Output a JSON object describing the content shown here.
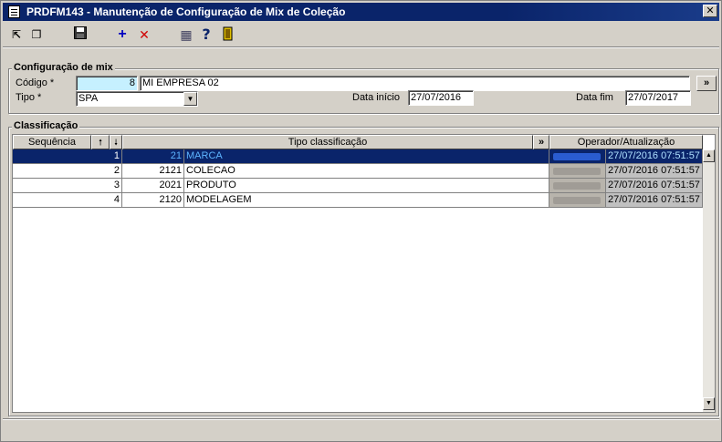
{
  "window": {
    "title": "PRDFM143 - Manutenção de Configuração de Mix de Coleção",
    "close_glyph": "✕"
  },
  "toolbar": {
    "buttons": [
      {
        "name": "export-icon",
        "glyph": "⇱"
      },
      {
        "name": "copy-icon",
        "glyph": "❐"
      },
      {
        "name": "save-icon",
        "glyph": "💾"
      },
      {
        "name": "add-icon",
        "glyph": "+"
      },
      {
        "name": "delete-icon",
        "glyph": "✕"
      },
      {
        "name": "calendar-icon",
        "glyph": "▦"
      },
      {
        "name": "help-icon",
        "glyph": "?"
      },
      {
        "name": "exit-door-icon",
        "glyph": "▯"
      }
    ]
  },
  "config": {
    "legend": "Configuração de mix",
    "codigo_label": "Código *",
    "codigo_value": "8",
    "empresa_value": "MI EMPRESA 02",
    "tipo_label": "Tipo *",
    "tipo_value": "SPA",
    "data_inicio_label": "Data início",
    "data_inicio_value": "27/07/2016",
    "data_fim_label": "Data fim",
    "data_fim_value": "27/07/2017",
    "lookup_button": "»"
  },
  "classificacao": {
    "legend": "Classificação",
    "headers": {
      "sequencia": "Sequência",
      "up": "🠕",
      "down": "🠗",
      "tipo": "Tipo classificação",
      "expand": "»",
      "operador": "Operador/Atualização"
    },
    "rows": [
      {
        "seq": "1",
        "codigo": "21",
        "descricao": "MARCA",
        "timestamp": "27/07/2016 07:51:57",
        "selected": true
      },
      {
        "seq": "2",
        "codigo": "2121",
        "descricao": "COLECAO",
        "timestamp": "27/07/2016 07:51:57",
        "selected": false
      },
      {
        "seq": "3",
        "codigo": "2021",
        "descricao": "PRODUTO",
        "timestamp": "27/07/2016 07:51:57",
        "selected": false
      },
      {
        "seq": "4",
        "codigo": "2120",
        "descricao": "MODELAGEM",
        "timestamp": "27/07/2016 07:51:57",
        "selected": false
      }
    ]
  },
  "colors": {
    "title_bar": "#0a246a",
    "selection": "#0a246a",
    "code_field_bg": "#c6f0ff",
    "add_icon": "#0000c0",
    "delete_icon": "#d00000"
  }
}
